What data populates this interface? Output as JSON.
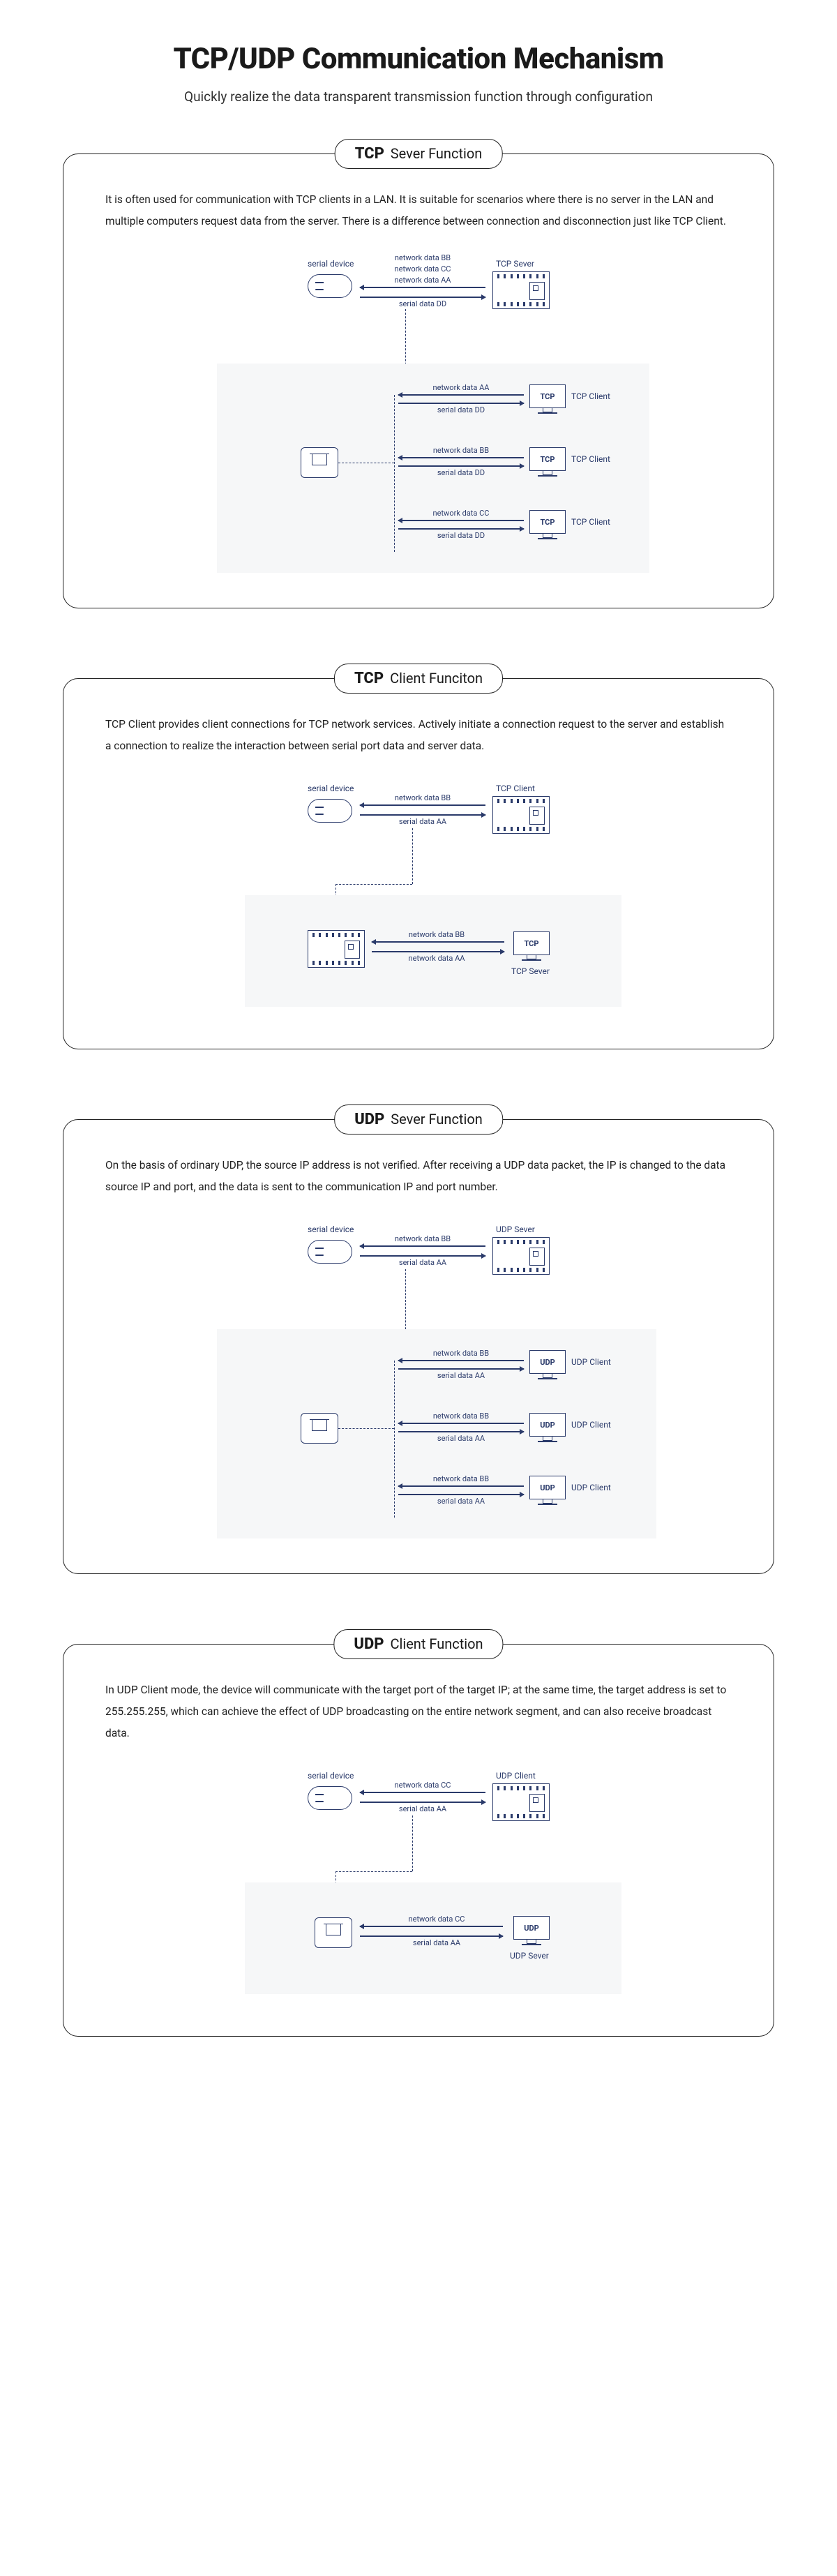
{
  "page": {
    "title": "TCP/UDP Communication Mechanism",
    "subtitle": "Quickly realize the data transparent transmission function through configuration"
  },
  "sections": {
    "tcp_server": {
      "proto": "TCP",
      "fn": "Sever Function",
      "desc": "It is often used for communication with TCP clients in a LAN. It is suitable for scenarios where there is no server in the LAN and multiple computers request data from the server. There is a difference between connection and disconnection just like TCP Client.",
      "serial_label": "serial device",
      "server_label": "TCP Sever",
      "top_lines": [
        "network data BB",
        "network data CC",
        "network data AA",
        "serial data DD"
      ],
      "clients": [
        {
          "up": "network data AA",
          "down": "serial data DD",
          "role": "TCP Client",
          "badge": "TCP"
        },
        {
          "up": "network data BB",
          "down": "serial data DD",
          "role": "TCP Client",
          "badge": "TCP"
        },
        {
          "up": "network data CC",
          "down": "serial data DD",
          "role": "TCP Client",
          "badge": "TCP"
        }
      ]
    },
    "tcp_client": {
      "proto": "TCP",
      "fn": "Client Funciton",
      "desc": "TCP Client provides client connections for TCP network services. Actively initiate a connection request to the server and establish a connection to realize the interaction between serial port data and server data.",
      "serial_label": "serial device",
      "client_label": "TCP Client",
      "top_up": "network data BB",
      "top_down": "serial data AA",
      "bottom_up": "network data BB",
      "bottom_down": "network data AA",
      "server_badge": "TCP",
      "server_label": "TCP Sever"
    },
    "udp_server": {
      "proto": "UDP",
      "fn": "Sever Function",
      "desc": "On the basis of ordinary UDP, the source IP address is not verified. After receiving a UDP data packet, the IP is changed to the data source IP and port, and the data is sent to the communication IP and port number.",
      "serial_label": "serial device",
      "server_label": "UDP Sever",
      "top_up": "network data BB",
      "top_down": "serial data AA",
      "clients": [
        {
          "up": "network data BB",
          "down": "serial data AA",
          "role": "UDP Client",
          "badge": "UDP"
        },
        {
          "up": "network data BB",
          "down": "serial data AA",
          "role": "UDP Client",
          "badge": "UDP"
        },
        {
          "up": "network data BB",
          "down": "serial data AA",
          "role": "UDP Client",
          "badge": "UDP"
        }
      ]
    },
    "udp_client": {
      "proto": "UDP",
      "fn": "Client Function",
      "desc": "In UDP Client mode, the device will communicate with the target port of the target IP; at the same time, the target address is set to 255.255.255, which can achieve the effect of UDP broadcasting on the entire network segment, and can also receive broadcast data.",
      "serial_label": "serial device",
      "client_label": "UDP Client",
      "top_up": "network data CC",
      "top_down": "serial data AA",
      "bottom_up": "network data CC",
      "bottom_down": "serial data AA",
      "server_badge": "UDP",
      "server_label": "UDP Sever"
    }
  }
}
